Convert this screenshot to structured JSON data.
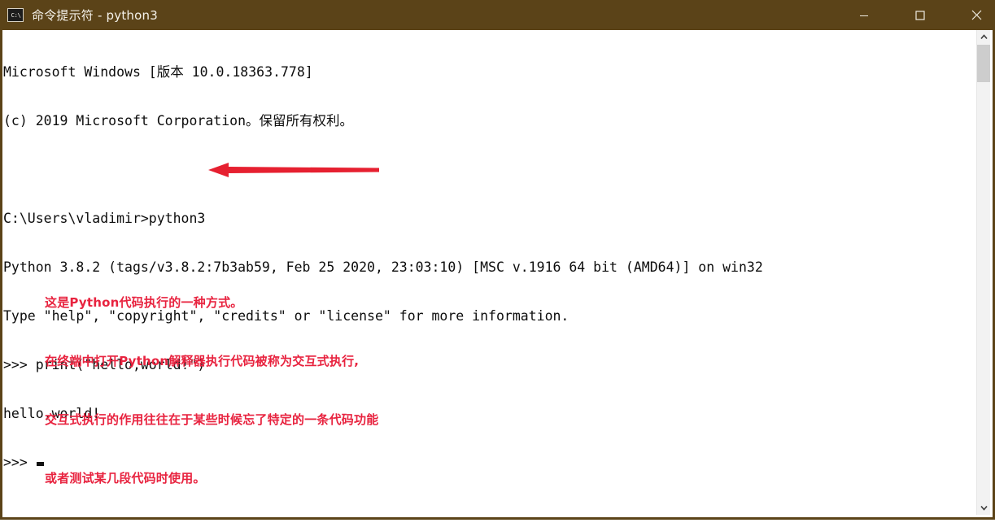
{
  "window": {
    "title": "命令提示符 - python3",
    "icon_name": "console-icon",
    "icon_glyph": "C:\\",
    "titlebar_color": "#5b4318",
    "controls": {
      "minimize_label": "Minimize",
      "maximize_label": "Maximize",
      "close_label": "Close"
    }
  },
  "console": {
    "lines": [
      "Microsoft Windows [版本 10.0.18363.778]",
      "(c) 2019 Microsoft Corporation。保留所有权利。",
      "",
      "C:\\Users\\vladimir>python3",
      "Python 3.8.2 (tags/v3.8.2:7b3ab59, Feb 25 2020, 23:03:10) [MSC v.1916 64 bit (AMD64)] on win32",
      "Type \"help\", \"copyright\", \"credits\" or \"license\" for more information.",
      ">>> print(\"hello,world!\")",
      "hello,world!"
    ],
    "prompt": ">>> ",
    "cursor": "block-cursor",
    "text_color": "#0d0d0d",
    "background_color": "#ffffff"
  },
  "annotation": {
    "color": "#e8233f",
    "arrow_name": "red-left-arrow",
    "lines": [
      "这是Python代码执行的一种方式。",
      "在终端中打开Python解释器执行代码被称为交互式执行,",
      "交互式执行的作用往往在于某些时候忘了特定的一条代码功能",
      "或者测试某几段代码时使用。"
    ]
  },
  "scrollbar": {
    "up_label": "Scroll up",
    "down_label": "Scroll down",
    "thumb_label": "Scroll thumb"
  }
}
